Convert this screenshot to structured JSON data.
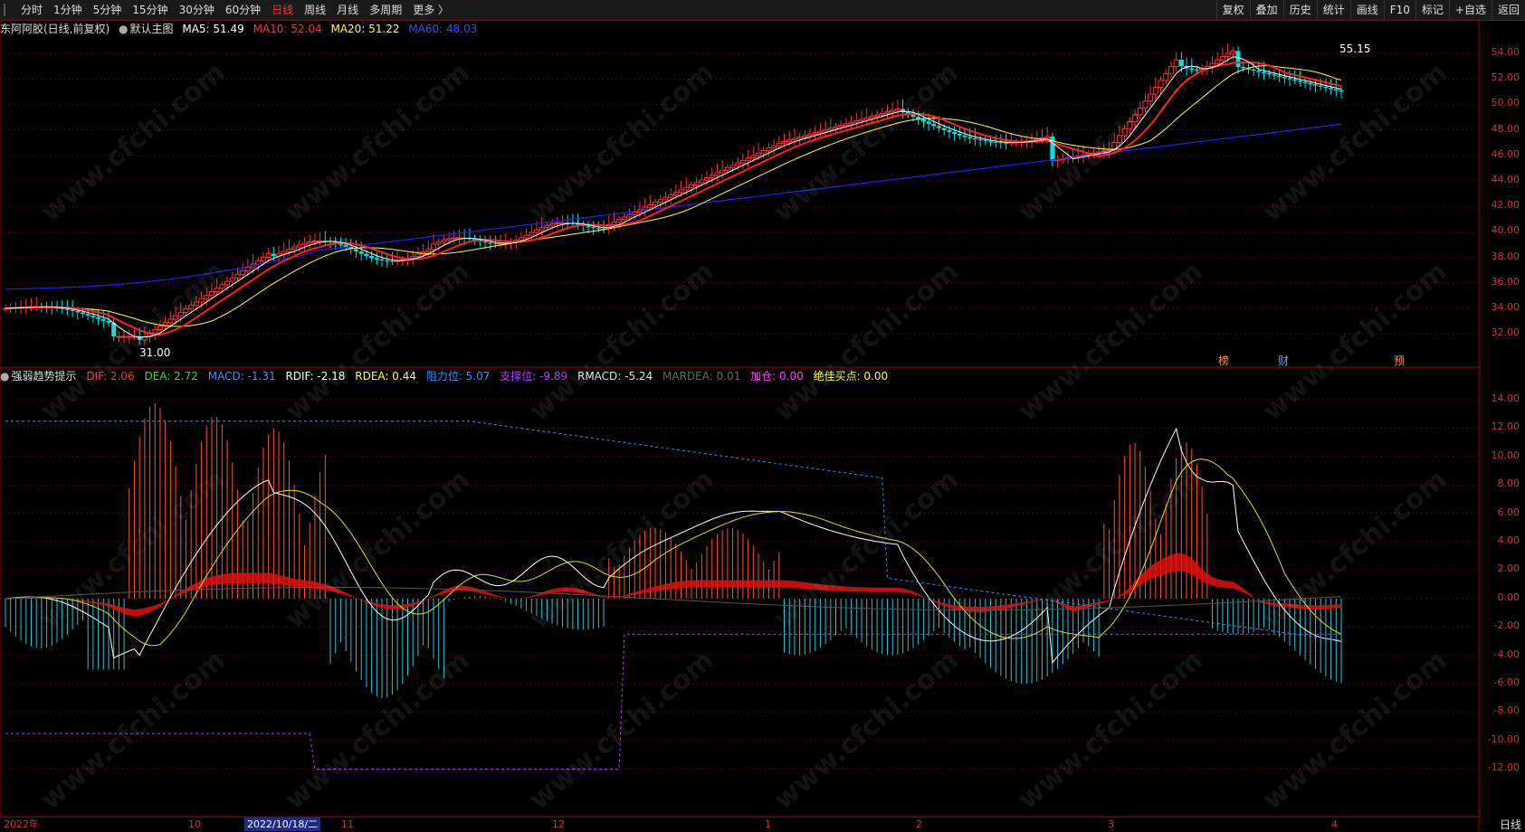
{
  "toolbar": {
    "periods": [
      "分时",
      "1分钟",
      "5分钟",
      "15分钟",
      "30分钟",
      "60分钟",
      "日线",
      "周线",
      "月线",
      "多周期",
      "更多 〉"
    ],
    "active_period": "日线",
    "right_items": [
      "复权",
      "叠加",
      "历史",
      "统计",
      "画线",
      "F10",
      "标记",
      "+自选",
      "返回"
    ]
  },
  "main_header": {
    "stock": "东阿阿胶(日线,前复权)",
    "indicator": "默认主图",
    "ma5": "MA5: 51.49",
    "ma10": "MA10: 52.04",
    "ma20": "MA20: 51.22",
    "ma60": "MA60: 48.03"
  },
  "sub_header": {
    "name": "强弱趋势提示",
    "dif": "DIF: 2.06",
    "dea": "DEA: 2.72",
    "macd": "MACD: -1.31",
    "rdif": "RDIF: -2.18",
    "rdea": "RDEA: 0.44",
    "resist": "阻力位: 5.07",
    "support": "支撑位: -9.89",
    "rmacd": "RMACD: -5.24",
    "mardea": "MARDEA: 0.01",
    "add": "加仓: 0.00",
    "buy": "绝佳买点: 0.00"
  },
  "price_axis": [
    "54.00",
    "52.00",
    "50.00",
    "48.00",
    "46.00",
    "44.00",
    "42.00",
    "40.00",
    "38.00",
    "36.00",
    "34.00",
    "32.00"
  ],
  "macd_axis": [
    "14.00",
    "12.00",
    "10.00",
    "8.00",
    "6.00",
    "4.00",
    "2.00",
    "0.00",
    "-2.00",
    "-4.00",
    "-6.00",
    "-8.00",
    "-10.00",
    "-12.00"
  ],
  "annotations": {
    "high": "55.15",
    "low": "31.00",
    "marks": [
      "榜",
      "财",
      "预"
    ]
  },
  "dates": {
    "labels": [
      "2022年",
      "10",
      "11",
      "12",
      "1",
      "2",
      "3",
      "4"
    ],
    "highlight": "2022/10/18/二"
  },
  "corner_label": "日线",
  "watermark": "www.cfchi.com",
  "colors": {
    "ma5": "#ffffff",
    "ma10": "#ff2020",
    "ma20": "#ffff40",
    "ma60": "#2020ff",
    "up": "#ff3030",
    "down": "#00e5e5"
  }
}
